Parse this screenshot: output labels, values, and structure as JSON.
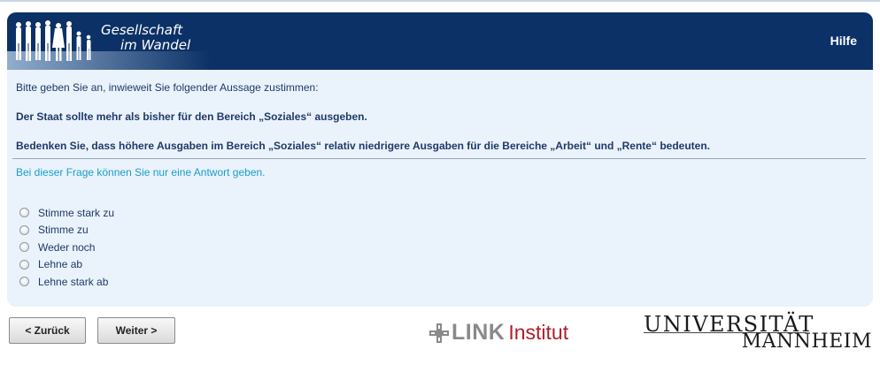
{
  "header": {
    "brand_line1": "Gesellschaft",
    "brand_line2": "im Wandel",
    "help_label": "Hilfe"
  },
  "question": {
    "intro": "Bitte geben Sie an, inwieweit Sie folgender Aussage zustimmen:",
    "statement": "Der Staat sollte mehr als bisher für den Bereich „Soziales“ ausgeben.",
    "consideration": "Bedenken Sie, dass höhere Ausgaben im Bereich „Soziales“ relativ niedrigere Ausgaben für die Bereiche „Arbeit“ und „Rente“ bedeuten.",
    "hint": "Bei dieser Frage können Sie nur eine Antwort geben."
  },
  "options": [
    {
      "label": "Stimme stark zu",
      "selected": false
    },
    {
      "label": "Stimme zu",
      "selected": false
    },
    {
      "label": "Weder noch",
      "selected": false
    },
    {
      "label": "Lehne ab",
      "selected": false
    },
    {
      "label": "Lehne stark ab",
      "selected": false
    }
  ],
  "nav": {
    "back_label": "< Zurück",
    "next_label": "Weiter >"
  },
  "logos": {
    "link_brand": "LINK",
    "link_suffix": "Institut",
    "uni_line1": "UNIVERSITÄT",
    "uni_line2": "MANNHEIM"
  },
  "colors": {
    "header_bg": "#0c3166",
    "panel_bg": "#eaf2fc",
    "hint_text": "#1aa0c8",
    "link_red": "#b01e2a"
  }
}
